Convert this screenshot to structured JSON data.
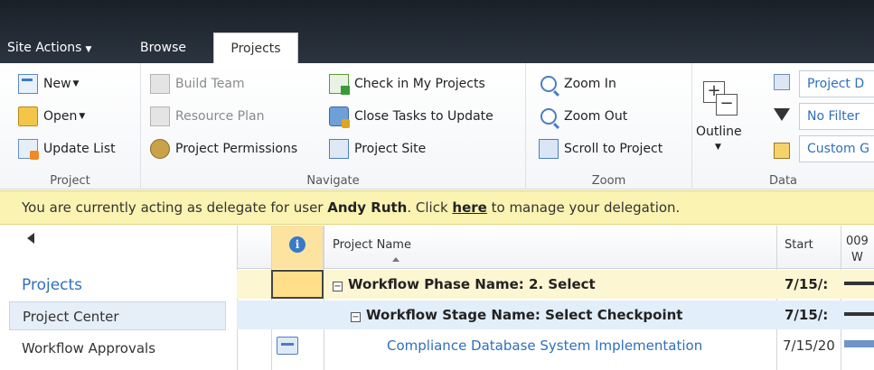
{
  "tabs": {
    "site_actions": "Site Actions",
    "browse": "Browse",
    "projects": "Projects"
  },
  "ribbon": {
    "project_group": {
      "label": "Project",
      "new": "New",
      "open": "Open",
      "update_list": "Update List"
    },
    "navigate_group": {
      "label": "Navigate",
      "build_team": "Build Team",
      "resource_plan": "Resource Plan",
      "project_permissions": "Project Permissions",
      "check_in": "Check in My Projects",
      "close_tasks": "Close Tasks to Update",
      "project_site": "Project Site"
    },
    "zoom_group": {
      "label": "Zoom",
      "zoom_in": "Zoom In",
      "zoom_out": "Zoom Out",
      "scroll_to_project": "Scroll to Project"
    },
    "data_group": {
      "label": "Data",
      "outline": "Outline",
      "view_select": "Project D",
      "filter_select": "No Filter",
      "group_select": "Custom G"
    }
  },
  "delegation": {
    "prefix": "You are currently acting as delegate for user ",
    "user": "Andy Ruth",
    "middle": ". Click ",
    "link": "here",
    "suffix": " to manage your delegation."
  },
  "nav": {
    "title": "Projects",
    "items": [
      "Project Center",
      "Workflow Approvals"
    ]
  },
  "grid": {
    "columns": {
      "info": "i",
      "project_name": "Project Name",
      "start": "Start",
      "timescale_year": "009",
      "timescale_day": "W"
    },
    "rows": [
      {
        "name": "Workflow Phase Name: 2. Select",
        "start": "7/15/:"
      },
      {
        "name": "Workflow Stage Name: Select Checkpoint",
        "start": "7/15/:"
      },
      {
        "name": "Compliance Database System Implementation",
        "start": "7/15/20"
      }
    ]
  },
  "colors": {
    "accent": "#2f6fbf",
    "delegation_bg": "#fbf3b2",
    "phase_row_bg": "#fdf6d3",
    "stage_row_bg": "#e2eefa",
    "indicator_selected": "#ffdf8a"
  }
}
